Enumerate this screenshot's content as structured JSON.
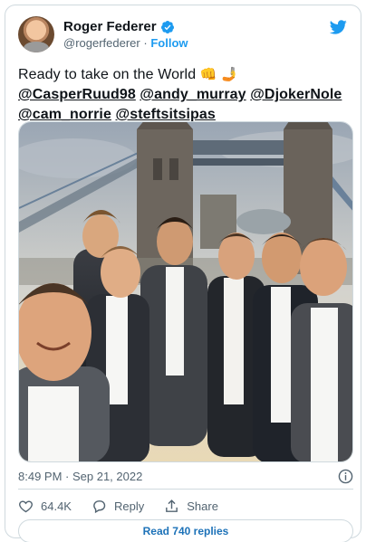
{
  "author": {
    "display_name": "Roger Federer",
    "handle": "@rogerfederer",
    "separator": "·",
    "follow_label": "Follow",
    "verified_icon": "verified-badge-icon",
    "brand_icon": "twitter-bird-icon"
  },
  "tweet": {
    "text_intro": "Ready to take on the World",
    "emojis": [
      "👊",
      "🤳"
    ],
    "mentions": [
      "@CasperRuud98",
      "@andy_murray",
      "@DjokerNole",
      "@cam_norrie",
      "@steftsitsipas"
    ]
  },
  "media": {
    "description_icon": "group-selfie-photo"
  },
  "meta": {
    "timestamp": "8:49 PM · Sep 21, 2022",
    "info_icon": "info-icon"
  },
  "actions": {
    "like_count": "64.4K",
    "reply_label": "Reply",
    "share_label": "Share"
  },
  "read_replies_label": "Read 740 replies",
  "colors": {
    "accent": "#1d9bf0",
    "text": "#0f1419",
    "muted": "#536471",
    "border": "#cfd9de"
  }
}
